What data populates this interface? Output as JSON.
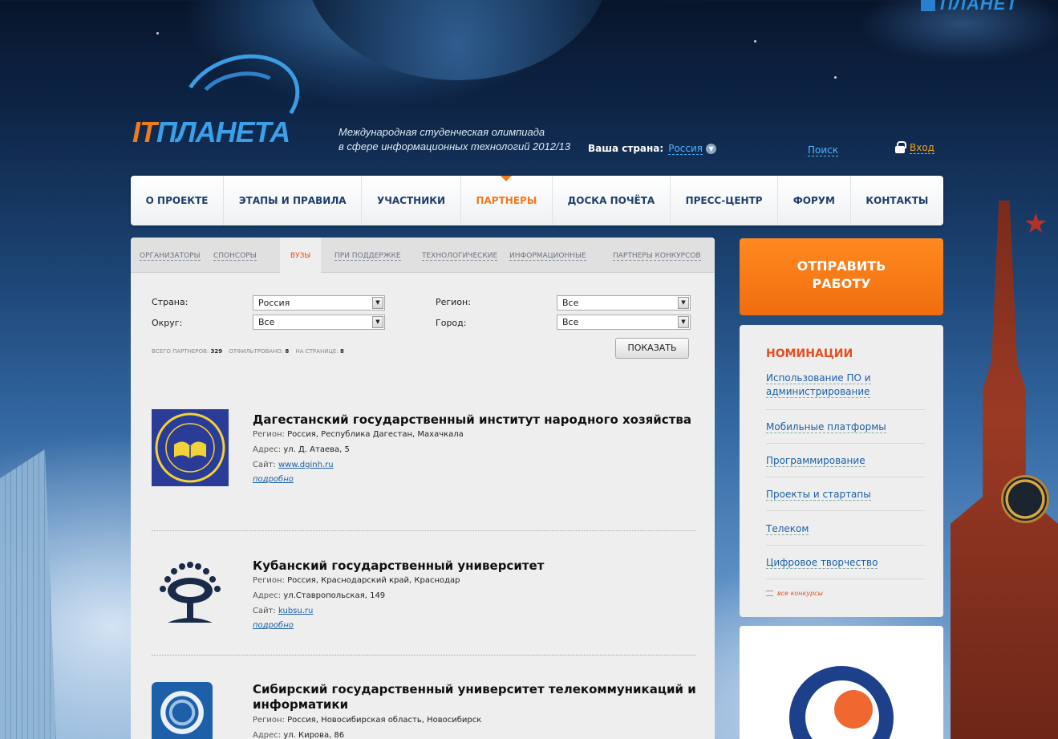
{
  "brand": {
    "logo_it": "IT",
    "logo_planeta": "ПЛАНЕТА",
    "mini_logo": "ПЛАНЕТ",
    "tagline_line1": "Международная студенческая олимпиада",
    "tagline_line2": "в сфере информационных технологий 2012/13"
  },
  "header": {
    "country_label": "Ваша страна:",
    "country_value": "Россия",
    "search": "Поиск",
    "login": "Вход"
  },
  "nav": [
    "О ПРОЕКТЕ",
    "ЭТАПЫ И ПРАВИЛА",
    "УЧАСТНИКИ",
    "ПАРТНЕРЫ",
    "ДОСКА ПОЧЁТА",
    "ПРЕСС-ЦЕНТР",
    "ФОРУМ",
    "КОНТАКТЫ"
  ],
  "nav_active": "ПАРТНЕРЫ",
  "subtabs": [
    "ОРГАНИЗАТОРЫ",
    "СПОНСОРЫ",
    "ВУЗЫ",
    "ПРИ ПОДДЕРЖКЕ",
    "ТЕХНОЛОГИЧЕСКИЕ",
    "ИНФОРМАЦИОННЫЕ",
    "ПАРТНЕРЫ КОНКУРСОВ"
  ],
  "subtab_active": "ВУЗЫ",
  "filters": {
    "country_label": "Страна:",
    "country_value": "Россия",
    "district_label": "Округ:",
    "district_value": "Все",
    "region_label": "Регион:",
    "region_value": "Все",
    "city_label": "Город:",
    "city_value": "Все",
    "show_button": "ПОКАЗАТЬ"
  },
  "stats": {
    "total_label": "ВСЕГО ПАРТНЕРОВ:",
    "total": "329",
    "filtered_label": "ОТФИЛЬТРОВАНО:",
    "filtered": "8",
    "page_label": "НА СТРАНИЦЕ:",
    "page": "8"
  },
  "universities": [
    {
      "name": "Дагестанский государственный институт народного хозяйства",
      "region_label": "Регион:",
      "region": "Россия, Республика Дагестан, Махачкала",
      "address_label": "Адрес:",
      "address": "ул. Д. Атаева, 5",
      "site_label": "Сайт:",
      "site": "www.dginh.ru",
      "more": "подробно"
    },
    {
      "name": "Кубанский государственный университет",
      "region_label": "Регион:",
      "region": "Россия, Краснодарский край, Краснодар",
      "address_label": "Адрес:",
      "address": "ул.Ставропольская, 149",
      "site_label": "Сайт:",
      "site": "kubsu.ru",
      "more": "подробно"
    },
    {
      "name": "Сибирский государственный университет телекоммуникаций и информатики",
      "region_label": "Регион:",
      "region": "Россия, Новосибирская область, Новосибирск",
      "address_label": "Адрес:",
      "address": "ул. Кирова, 86"
    }
  ],
  "sidebar": {
    "submit_line1": "ОТПРАВИТЬ",
    "submit_line2": "РАБОТУ",
    "nominations_title": "НОМИНАЦИИ",
    "nominations": [
      "Использование ПО и администрирование",
      "Мобильные платформы",
      "Программирование",
      "Проекты и стартапы",
      "Телеком",
      "Цифровое творчество"
    ],
    "all_contests": "все конкурсы"
  },
  "colors": {
    "accent": "#f07a20",
    "link": "#1b5fa5",
    "nav_text": "#1f3d6b",
    "nomination_title": "#e05020"
  }
}
